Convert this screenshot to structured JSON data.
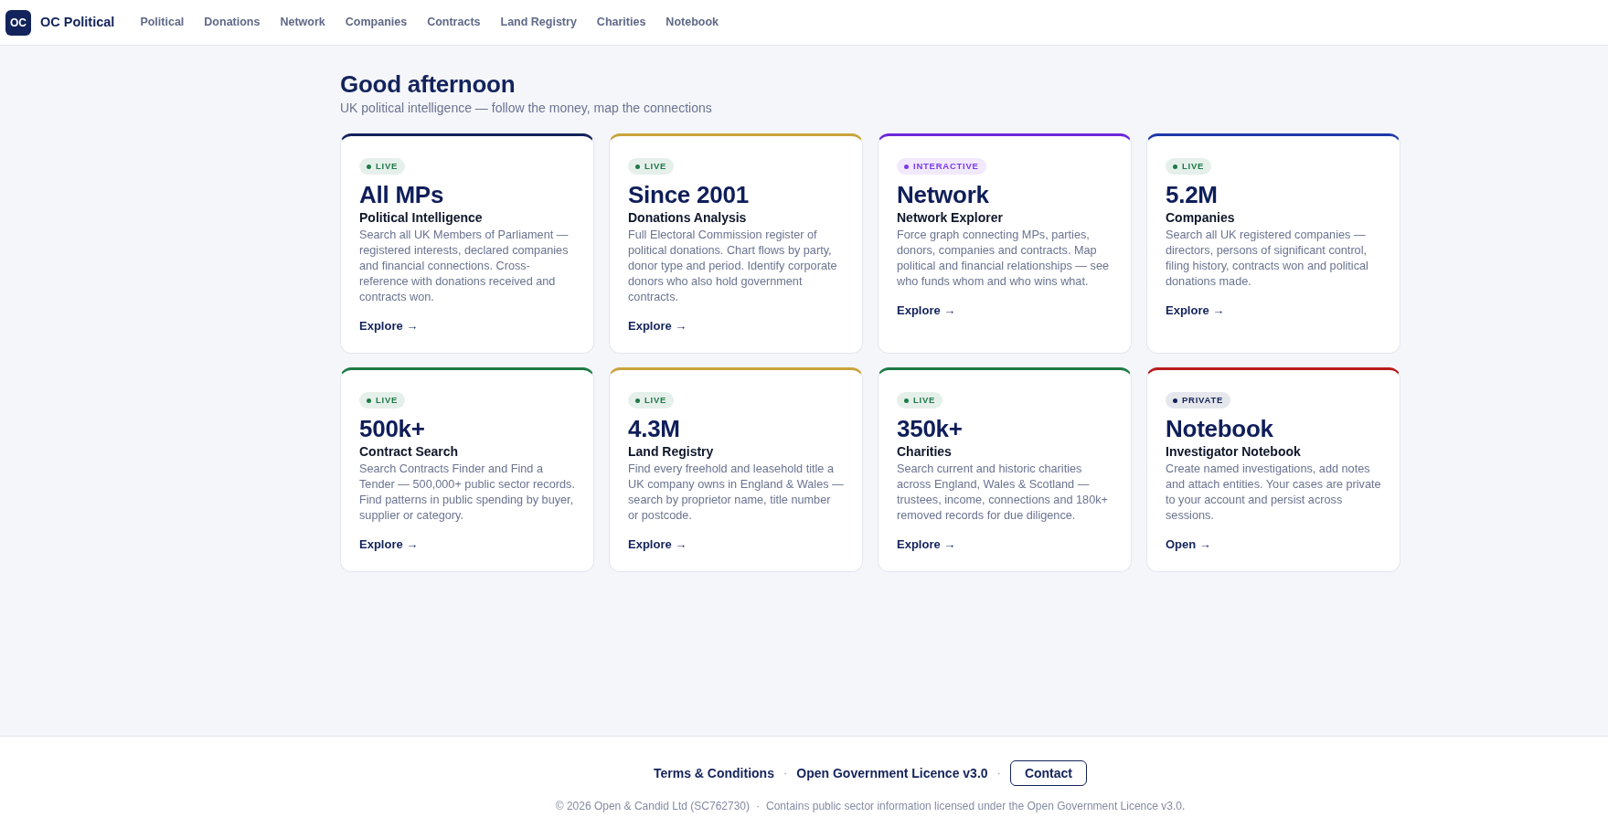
{
  "header": {
    "logo": "OC",
    "brand": "OC Political",
    "nav": [
      "Political",
      "Donations",
      "Network",
      "Companies",
      "Contracts",
      "Land Registry",
      "Charities",
      "Notebook"
    ]
  },
  "greeting": {
    "title": "Good afternoon",
    "subtitle": "UK political intelligence — follow the money, map the connections"
  },
  "cards": [
    {
      "color": "#13235b",
      "badge": {
        "label": "LIVE",
        "color": "#1e7a46"
      },
      "stat": "All MPs",
      "title": "Political Intelligence",
      "description": "Search all UK Members of Parliament — registered interests, declared companies and financial connections. Cross-reference with donations received and contracts won.",
      "link": "Explore →"
    },
    {
      "color": "#c8a43c",
      "badge": {
        "label": "LIVE",
        "color": "#1e7a46"
      },
      "stat": "Since 2001",
      "title": "Donations Analysis",
      "description": "Full Electoral Commission register of political donations. Chart flows by party, donor type and period. Identify corporate donors who also hold government contracts.",
      "link": "Explore →"
    },
    {
      "color": "#6d28d9",
      "badge": {
        "label": "INTERACTIVE",
        "color": "#7c3aed"
      },
      "stat": "Network",
      "title": "Network Explorer",
      "description": "Force graph connecting MPs, parties, donors, companies and contracts. Map political and financial relationships — see who funds whom and who wins what.",
      "link": "Explore →"
    },
    {
      "color": "#1e3aa8",
      "badge": {
        "label": "LIVE",
        "color": "#1e7a46"
      },
      "stat": "5.2M",
      "title": "Companies",
      "description": "Search all UK registered companies — directors, persons of significant control, filing history, contracts won and political donations made.",
      "link": "Explore →"
    },
    {
      "color": "#1e7a46",
      "badge": {
        "label": "LIVE",
        "color": "#1e7a46"
      },
      "stat": "500k+",
      "title": "Contract Search",
      "description": "Search Contracts Finder and Find a Tender — 500,000+ public sector records. Find patterns in public spending by buyer, supplier or category.",
      "link": "Explore →"
    },
    {
      "color": "#c8a43c",
      "badge": {
        "label": "LIVE",
        "color": "#1e7a46"
      },
      "stat": "4.3M",
      "title": "Land Registry",
      "description": "Find every freehold and leasehold title a UK company owns in England & Wales — search by proprietor name, title number or postcode.",
      "link": "Explore →"
    },
    {
      "color": "#1e7a46",
      "badge": {
        "label": "LIVE",
        "color": "#1e7a46"
      },
      "stat": "350k+",
      "title": "Charities",
      "description": "Search current and historic charities across England, Wales & Scotland — trustees, income, connections and 180k+ removed records for due diligence.",
      "link": "Explore →"
    },
    {
      "color": "#b91c1c",
      "badge": {
        "label": "PRIVATE",
        "color": "#13235b"
      },
      "stat": "Notebook",
      "title": "Investigator Notebook",
      "description": "Create named investigations, add notes and attach entities. Your cases are private to your account and persist across sessions.",
      "link": "Open →"
    }
  ],
  "footer": {
    "links": [
      {
        "kind": "link",
        "label": "Terms & Conditions"
      },
      {
        "kind": "separator",
        "label": "·"
      },
      {
        "kind": "link",
        "label": "Open Government Licence v3.0"
      },
      {
        "kind": "separator",
        "label": "·"
      },
      {
        "kind": "button",
        "label": "Contact"
      }
    ],
    "legal": {
      "owner": "© 2026 Open & Candid Ltd (SC762730)",
      "separator": "·",
      "notice": "Contains public sector information licensed under the Open Government Licence v3.0."
    }
  }
}
